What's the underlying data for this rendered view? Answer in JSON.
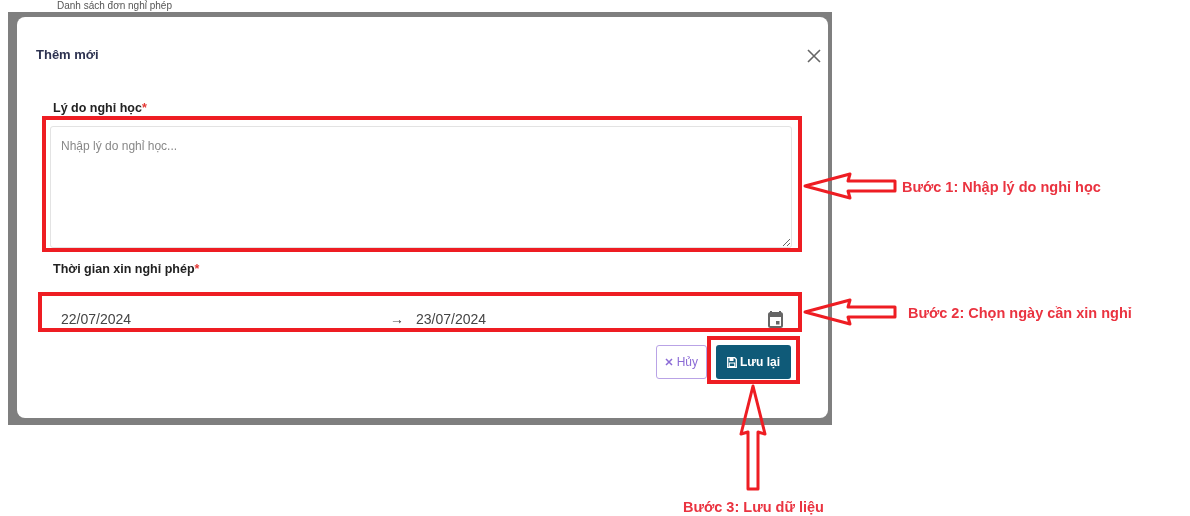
{
  "background_page": {
    "heading": "Danh sách đơn nghỉ phép"
  },
  "dialog": {
    "title": "Thêm mới",
    "fields": [
      {
        "kind": "textarea",
        "label": "Lý do nghỉ học",
        "required_mark": "*",
        "placeholder": "Nhập lý do nghỉ học..."
      },
      {
        "kind": "date_range",
        "label": "Thời gian xin nghỉ phép",
        "required_mark": "*",
        "start": "22/07/2024",
        "separator": "→",
        "end": "23/07/2024"
      }
    ],
    "buttons": [
      {
        "kind": "cancel",
        "label": "Hủy"
      },
      {
        "kind": "save",
        "label": "Lưu lại"
      }
    ]
  },
  "annotations": [
    {
      "text": "Bước 1: Nhập lý do nghỉ học"
    },
    {
      "text": "Bước 2: Chọn ngày cần xin nghỉ"
    },
    {
      "text": "Bước 3: Lưu dữ liệu"
    }
  ]
}
